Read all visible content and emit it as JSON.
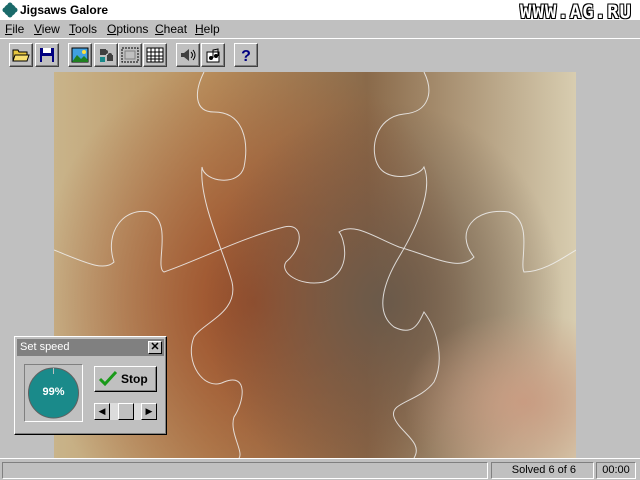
{
  "window": {
    "title": "Jigsaws Galore",
    "icon": "puzzle-piece-icon",
    "watermark": "WWW.AG.RU"
  },
  "menu": [
    "File",
    "View",
    "Tools",
    "Options",
    "Cheat",
    "Help"
  ],
  "toolbar": {
    "buttons": [
      {
        "name": "open-button",
        "icon": "folder-open-icon"
      },
      {
        "name": "save-button",
        "icon": "floppy-disk-icon"
      },
      {
        "name": "picture-button",
        "icon": "landscape-picture-icon"
      },
      {
        "name": "pieces-button",
        "icon": "puzzle-pieces-icon"
      },
      {
        "name": "edge-pieces-button",
        "icon": "edge-grid-icon"
      },
      {
        "name": "all-pieces-button",
        "icon": "full-grid-icon"
      },
      {
        "name": "sound-button",
        "icon": "speaker-icon"
      },
      {
        "name": "music-button",
        "icon": "music-icon"
      },
      {
        "name": "help-button",
        "icon": "question-mark-icon"
      }
    ]
  },
  "speed_dialog": {
    "title": "Set speed",
    "close_label": "✕",
    "gauge_value": "99%",
    "gauge_fraction": 0.99,
    "stop_label": "Stop",
    "slider_left": "◀",
    "slider_right": "▶",
    "slider_fraction": 0.5
  },
  "status": {
    "main": "",
    "solved": "Solved 6 of 6",
    "time": "00:00"
  },
  "colors": {
    "gauge_fill": "#1a8a8a",
    "stop_check": "#1a9a1a",
    "title_inactive": "#808080"
  }
}
